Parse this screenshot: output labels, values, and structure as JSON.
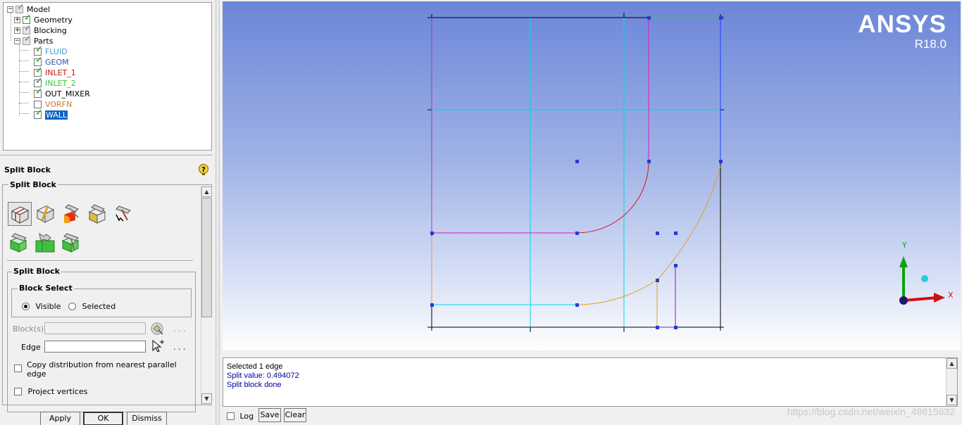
{
  "tree": {
    "items": [
      {
        "label": "Model"
      },
      {
        "label": "Geometry"
      },
      {
        "label": "Blocking"
      },
      {
        "label": "Parts"
      },
      {
        "label": "FLUID",
        "color": "#3aa0d0"
      },
      {
        "label": "GEOM",
        "color": "#3050b0"
      },
      {
        "label": "INLET_1",
        "color": "#c01818"
      },
      {
        "label": "INLET_2",
        "color": "#40c040"
      },
      {
        "label": "OUT_MIXER",
        "color": "#000000"
      },
      {
        "label": "VORFN",
        "color": "#d07820"
      },
      {
        "label": "WALL",
        "color": "#ffffff"
      }
    ]
  },
  "panel": {
    "title": "Split Block",
    "section_title": "Split Block",
    "subsection_title": "Split Block",
    "block_select": {
      "title": "Block Select",
      "visible_label": "Visible",
      "selected_label": "Selected",
      "choice": "Visible"
    },
    "blocks_label": "Block(s)",
    "blocks_value": "",
    "edge_label": "Edge",
    "edge_value": "",
    "dots": ". . .",
    "copy_dist_label_1": "Copy distribution from nearest parallel",
    "copy_dist_label_2": "edge",
    "project_vertices_label": "Project vertices",
    "tool_icons": [
      "split-block-icon",
      "prescribed-point-split-icon",
      "split-face-icon",
      "split-free-face-icon",
      "split-o-grid-icon",
      "extend-split-icon",
      "split-by-edge-icon",
      "split-y-block-icon"
    ]
  },
  "buttons": {
    "apply": "Apply",
    "ok": "OK",
    "dismiss": "Dismiss"
  },
  "brand": {
    "name": "ANSYS",
    "version": "R18.0"
  },
  "axes": {
    "x": "X",
    "y": "Y"
  },
  "messages": {
    "lines": [
      "Selected 1 edge",
      "Split value: 0.494072",
      "Split block done"
    ],
    "line_colors": [
      "#000000",
      "#0000a0",
      "#0000a0"
    ]
  },
  "bottom": {
    "log_label": "Log",
    "save_label": "Save",
    "clear_label": "Clear"
  },
  "watermark": "https://blog.csdn.net/weixin_48615832",
  "colors": {
    "cyan": "#00d8e8",
    "magenta": "#d020c0",
    "red": "#d01818",
    "orange": "#e0a020",
    "blue": "#1e40ff",
    "green": "#30d030",
    "purple": "#8020b0",
    "vertex": "#2a3ad0"
  }
}
